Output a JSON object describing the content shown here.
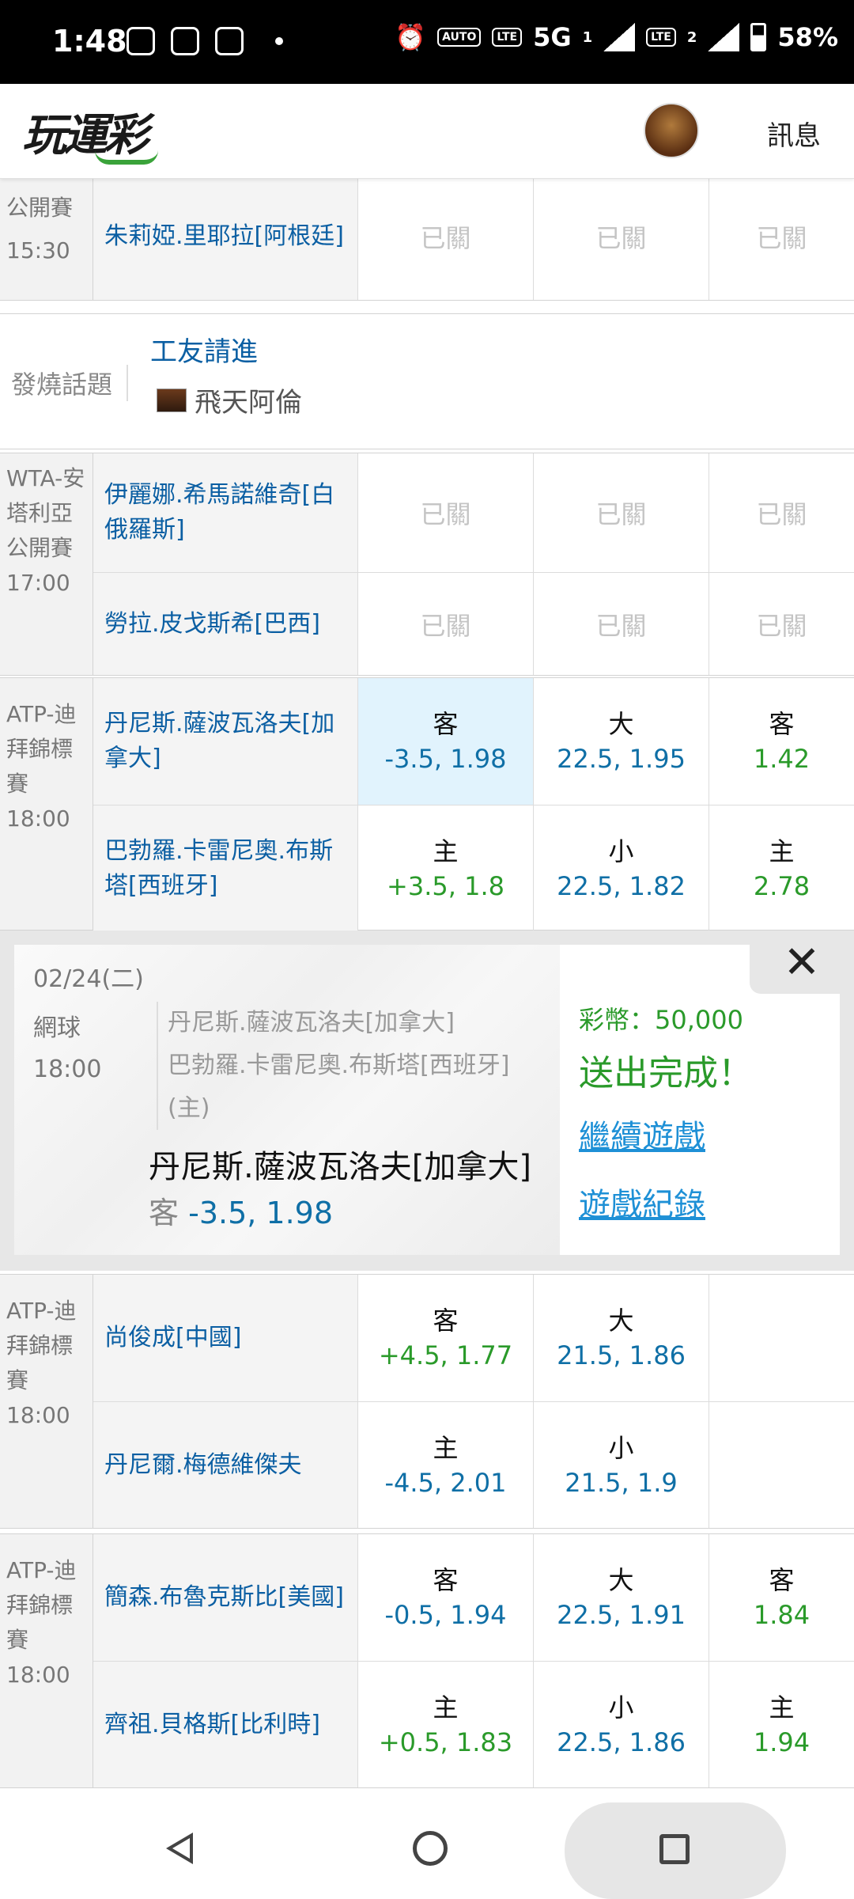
{
  "status_bar": {
    "time": "1:48",
    "network": "5G",
    "sim1": "1",
    "sim2": "2",
    "battery": "58%"
  },
  "app_bar": {
    "logo": "玩運彩",
    "messages_label": "訊息"
  },
  "partial_match": {
    "league": "公開賽",
    "time": "15:30",
    "player": "朱莉婭.里耶拉[阿根廷]",
    "closed_label": "已關"
  },
  "hot_topic": {
    "label": "發燒話題",
    "title": "工友請進",
    "author": "飛天阿倫"
  },
  "matches": [
    {
      "league": "WTA-安塔利亞公開賽",
      "time": "17:00",
      "rows": [
        {
          "player": "伊麗娜.希馬諾維奇[白俄羅斯]",
          "c1": "已關",
          "c2": "已關",
          "c3": "已關"
        },
        {
          "player": "勞拉.皮戈斯希[巴西]",
          "c1": "已關",
          "c2": "已關",
          "c3": "已關"
        }
      ]
    },
    {
      "league": "ATP-迪拜錦標賽",
      "time": "18:00",
      "rows": [
        {
          "player": "丹尼斯.薩波瓦洛夫[加拿大]",
          "c1_type": "客",
          "c1_val": "-3.5, 1.98",
          "c2_type": "大",
          "c2_val": "22.5, 1.95",
          "c3_type": "客",
          "c3_val": "1.42"
        },
        {
          "player": "巴勃羅.卡雷尼奧.布斯塔[西班牙]",
          "c1_type": "主",
          "c1_val": "+3.5, 1.8",
          "c2_type": "小",
          "c2_val": "22.5, 1.82",
          "c3_type": "主",
          "c3_val": "2.78"
        }
      ]
    },
    {
      "league": "ATP-迪拜錦標賽",
      "time": "18:00",
      "rows": [
        {
          "player": "尚俊成[中國]",
          "c1_type": "客",
          "c1_val": "+4.5, 1.77",
          "c2_type": "大",
          "c2_val": "21.5, 1.86"
        },
        {
          "player": "丹尼爾.梅德維傑夫",
          "c1_type": "主",
          "c1_val": "-4.5, 2.01",
          "c2_type": "小",
          "c2_val": "21.5, 1.9"
        }
      ]
    },
    {
      "league": "ATP-迪拜錦標賽",
      "time": "18:00",
      "rows": [
        {
          "player": "簡森.布魯克斯比[美國]",
          "c1_type": "客",
          "c1_val": "-0.5, 1.94",
          "c2_type": "大",
          "c2_val": "22.5, 1.91",
          "c3_type": "客",
          "c3_val": "1.84"
        },
        {
          "player": "齊祖.貝格斯[比利時]",
          "c1_type": "主",
          "c1_val": "+0.5, 1.83",
          "c2_type": "小",
          "c2_val": "22.5, 1.86",
          "c3_type": "主",
          "c3_val": "1.94"
        }
      ]
    }
  ],
  "bet_ticket": {
    "date": "02/24(二)",
    "sport": "網球",
    "time": "18:00",
    "match_line1": "丹尼斯.薩波瓦洛夫[加拿大]",
    "match_line2": "巴勃羅.卡雷尼奧.布斯塔[西班牙]",
    "match_line3": "(主)",
    "pick": "丹尼斯.薩波瓦洛夫[加拿大]",
    "pick_side": "客",
    "pick_odds": "-3.5, 1.98",
    "coins": "彩幣：50,000",
    "result": "送出完成！",
    "continue_link": "繼續遊戲",
    "history_link": "遊戲紀錄"
  },
  "colors": {
    "odds_blue": "#0f6fa6",
    "odds_green": "#2a9a2a",
    "selected_bg": "#e1f3fd",
    "link": "#1e90d6"
  }
}
